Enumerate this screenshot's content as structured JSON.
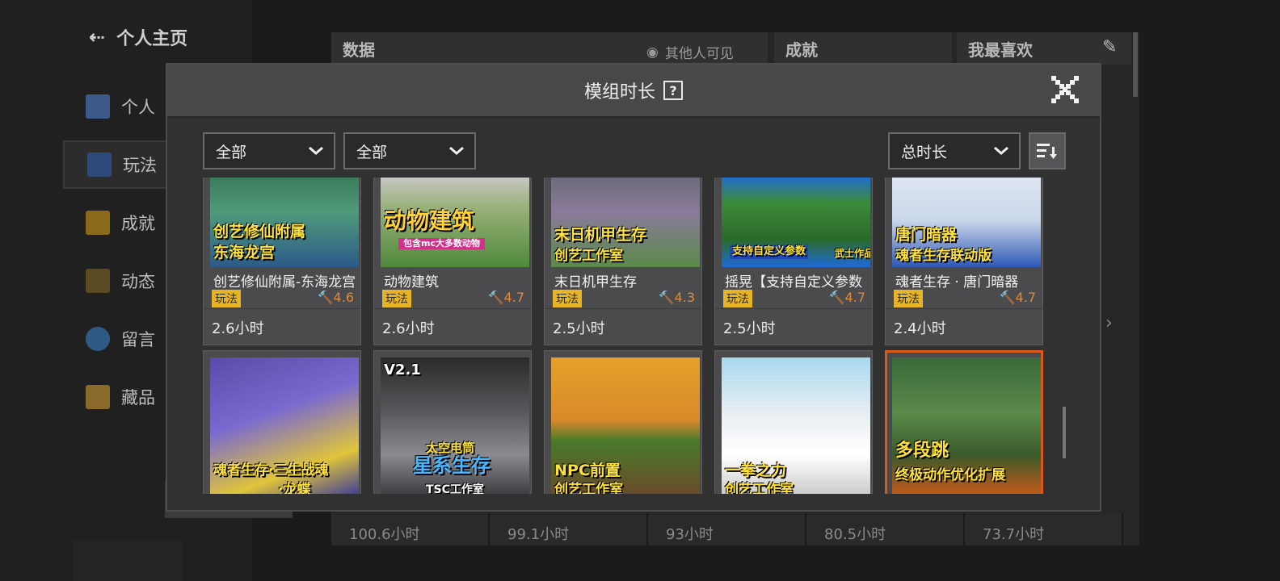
{
  "background": {
    "back_label": "个人主页",
    "nav": [
      "个人",
      "玩法",
      "成就",
      "动态",
      "留言",
      "藏品"
    ],
    "panels": {
      "data": "数据",
      "visible": "其他人可见",
      "achievement": "成就",
      "favorite": "我最喜欢"
    },
    "bottom_hours": [
      "100.6小时",
      "99.1小时",
      "93小时",
      "80.5小时",
      "73.7小时"
    ]
  },
  "modal": {
    "title": "模组时长",
    "help_icon": "?",
    "filter1": "全部",
    "filter2": "全部",
    "sort_by": "总时长"
  },
  "cards_row1": [
    {
      "name": "创艺修仙附属-东海龙宫",
      "tag": "玩法",
      "rating": "4.6",
      "hours": "2.6小时",
      "thumb_text": [
        "创艺修仙附属",
        "东海龙宫"
      ]
    },
    {
      "name": "动物建筑",
      "tag": "玩法",
      "rating": "4.7",
      "hours": "2.6小时",
      "thumb_text": [
        "动物建筑",
        "包含mc大多数动物"
      ]
    },
    {
      "name": "末日机甲生存",
      "tag": "玩法",
      "rating": "4.3",
      "hours": "2.5小时",
      "thumb_text": [
        "末日机甲生存",
        "创艺工作室"
      ]
    },
    {
      "name": "摇晃【支持自定义参数",
      "tag": "玩法",
      "rating": "4.7",
      "hours": "2.5小时",
      "thumb_text": [
        "支持自定义参数",
        "武士作品"
      ]
    },
    {
      "name": "魂者生存 · 唐门暗器",
      "tag": "玩法",
      "rating": "4.7",
      "hours": "2.4小时",
      "thumb_text": [
        "唐门暗器",
        "魂者生存联动版"
      ]
    }
  ],
  "cards_row2": [
    {
      "thumb_text": [
        "魂者生存·三生战魂",
        "·龙蝶"
      ]
    },
    {
      "thumb_text": [
        "V2.1",
        "太空电筒",
        "星系生存",
        "TSC工作室"
      ]
    },
    {
      "thumb_text": [
        "NPC前置",
        "创艺工作室"
      ]
    },
    {
      "thumb_text": [
        "一拳之力",
        "创艺工作室"
      ]
    },
    {
      "thumb_text": [
        "多段跳",
        "终极动作优化扩展"
      ]
    }
  ],
  "colors": {
    "tag_bg": "#e6b424",
    "rating": "#e08a3a",
    "thumb_title": "#ffe23a"
  }
}
